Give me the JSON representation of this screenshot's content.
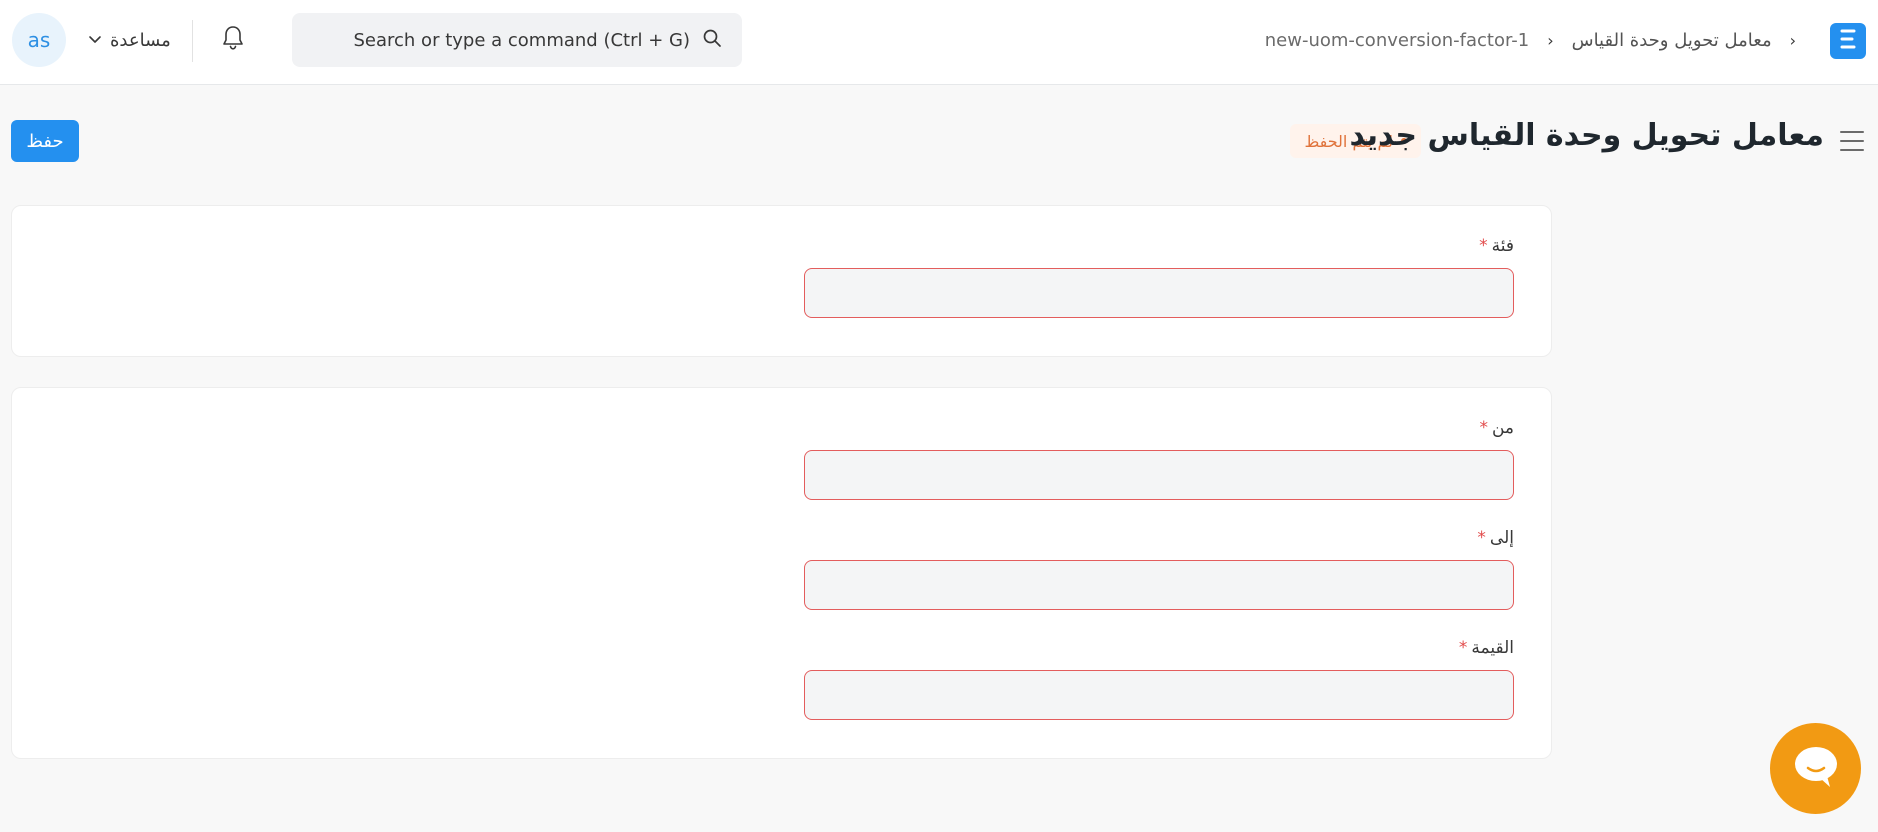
{
  "navbar": {
    "avatar_initials": "as",
    "help_label": "مساعدة",
    "search_placeholder": "Search or type a command (Ctrl + G)",
    "breadcrumbs": [
      "معامل تحويل وحدة القياس",
      "new-uom-conversion-factor-1"
    ]
  },
  "page": {
    "title": "معامل تحويل وحدة القياس جديد",
    "status": "لم يتم الحفظ",
    "save_label": "حفظ"
  },
  "form": {
    "category": {
      "label": "فئة",
      "value": ""
    },
    "from": {
      "label": "من",
      "value": ""
    },
    "to": {
      "label": "إلى",
      "value": ""
    },
    "value": {
      "label": "القيمة",
      "value": ""
    },
    "required_mark": "*"
  },
  "colors": {
    "primary": "#2490ef",
    "status_text": "#e0733b",
    "status_bg": "#fff3ec",
    "required": "#e24c4c",
    "chat": "#f29a13"
  },
  "icons": [
    "chevron-down-icon",
    "bell-icon",
    "search-icon",
    "app-logo-icon",
    "menu-icon",
    "chat-icon"
  ]
}
